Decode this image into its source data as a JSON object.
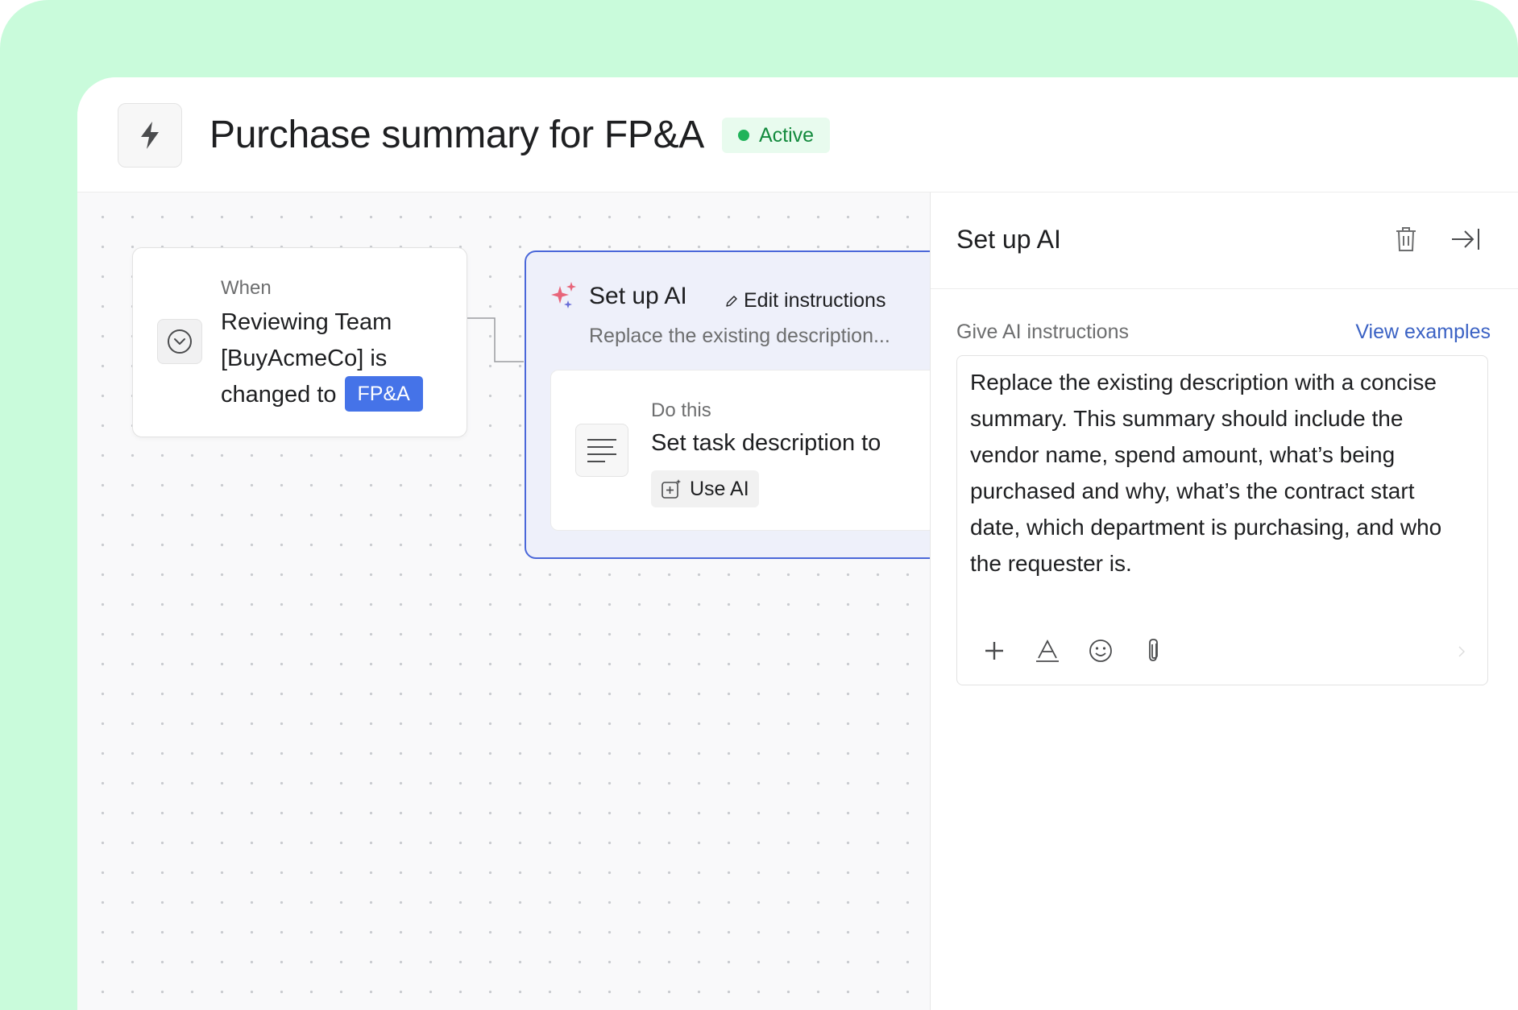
{
  "header": {
    "title": "Purchase summary for FP&A",
    "status": "Active",
    "app_icon": "lightning-bolt-icon"
  },
  "canvas": {
    "trigger": {
      "label": "When",
      "text": "Reviewing Team [BuyAcmeCo] is changed to",
      "tag": "FP&A",
      "icon": "chevron-down-circle-icon"
    },
    "ai_step": {
      "title": "Set up AI",
      "edit_label": "Edit instructions",
      "description": "Replace the existing description...",
      "action": {
        "label": "Do this",
        "text": "Set task description to",
        "button": "Use AI",
        "icon": "text-lines-icon"
      }
    }
  },
  "panel": {
    "title": "Set up AI",
    "instructions_label": "Give AI instructions",
    "view_examples": "View examples",
    "instructions_text": "Replace the existing description with a concise summary. This summary should include the vendor name, spend amount, what’s being purchased and why, what’s the contract start date, which department is purchasing, and who the requester is."
  },
  "colors": {
    "accent_green_bg": "#c9fbdb",
    "active_green": "#20b35a",
    "tag_blue": "#4573e8",
    "ai_card_border": "#4a67d9",
    "link_blue": "#3b62c4"
  }
}
